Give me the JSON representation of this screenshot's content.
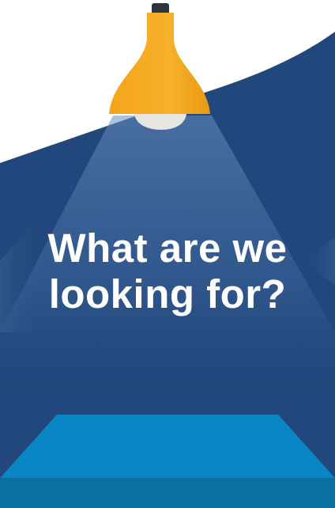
{
  "headline": {
    "line1": "What are we",
    "line2": "looking for?"
  },
  "icons": {
    "lamp": "pendant-lamp-icon",
    "light_beam": "light-beam-icon",
    "spotlight_floor": "spotlight-floor-icon"
  },
  "colors": {
    "background_white": "#ffffff",
    "navy": "#21477c",
    "lamp_body": "#f5a81c",
    "lamp_cap": "#2b3440",
    "bulb": "#e8e6e1",
    "floor_light": "#0a86c6",
    "floor_dark": "#0c6fa2",
    "text": "#ffffff"
  }
}
